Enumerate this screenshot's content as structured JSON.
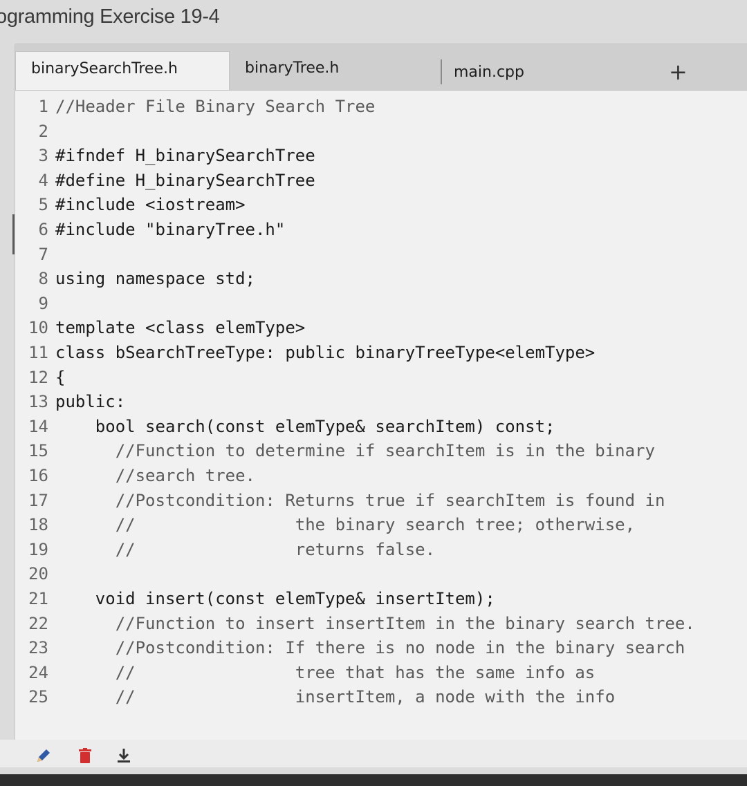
{
  "page": {
    "title": "ogramming Exercise 19-4"
  },
  "tabs": [
    {
      "label": "binarySearchTree.h",
      "active": true
    },
    {
      "label": "binaryTree.h",
      "active": false
    },
    {
      "label": "main.cpp",
      "active": false
    }
  ],
  "tab_add_label": "+",
  "code_lines": [
    {
      "num": "1",
      "text": "//Header File Binary Search Tree"
    },
    {
      "num": "2",
      "text": ""
    },
    {
      "num": "3",
      "text": "#ifndef H_binarySearchTree"
    },
    {
      "num": "4",
      "text": "#define H_binarySearchTree"
    },
    {
      "num": "5",
      "text": "#include <iostream>"
    },
    {
      "num": "6",
      "text": "#include \"binaryTree.h\""
    },
    {
      "num": "7",
      "text": ""
    },
    {
      "num": "8",
      "text": "using namespace std;"
    },
    {
      "num": "9",
      "text": ""
    },
    {
      "num": "10",
      "text": "template <class elemType>"
    },
    {
      "num": "11",
      "text": "class bSearchTreeType: public binaryTreeType<elemType>"
    },
    {
      "num": "12",
      "text": "{"
    },
    {
      "num": "13",
      "text": "public:"
    },
    {
      "num": "14",
      "text": "    bool search(const elemType& searchItem) const;"
    },
    {
      "num": "15",
      "text": "      //Function to determine if searchItem is in the binary"
    },
    {
      "num": "16",
      "text": "      //search tree."
    },
    {
      "num": "17",
      "text": "      //Postcondition: Returns true if searchItem is found in"
    },
    {
      "num": "18",
      "text": "      //                the binary search tree; otherwise,"
    },
    {
      "num": "19",
      "text": "      //                returns false."
    },
    {
      "num": "20",
      "text": ""
    },
    {
      "num": "21",
      "text": "    void insert(const elemType& insertItem);"
    },
    {
      "num": "22",
      "text": "      //Function to insert insertItem in the binary search tree."
    },
    {
      "num": "23",
      "text": "      //Postcondition: If there is no node in the binary search"
    },
    {
      "num": "24",
      "text": "      //                tree that has the same info as"
    },
    {
      "num": "25",
      "text": "      //                insertItem, a node with the info"
    }
  ],
  "toolbar": {
    "edit_icon": "pencil-icon",
    "delete_icon": "trash-icon",
    "download_icon": "download-icon"
  },
  "colors": {
    "delete": "#d32f2f",
    "edit": "#2e5aa8",
    "download": "#333333"
  }
}
